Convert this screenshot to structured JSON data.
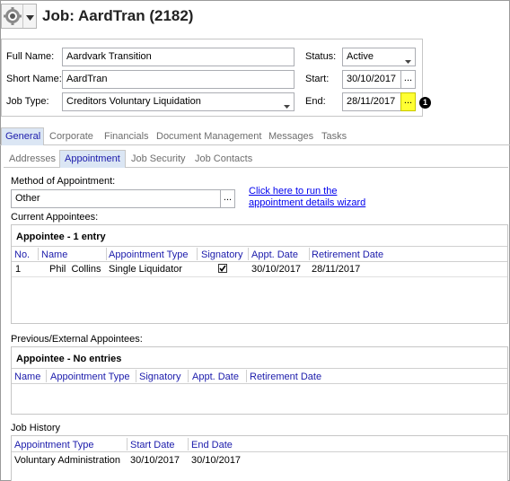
{
  "header": {
    "title": "Job: AardTran (2182)",
    "app_icon": "gear-icon",
    "dropdown_icon": "chevron-down-icon"
  },
  "job": {
    "full_name_label": "Full Name:",
    "full_name": "Aardvark Transition",
    "short_name_label": "Short Name:",
    "short_name": "AardTran",
    "job_type_label": "Job Type:",
    "job_type": "Creditors Voluntary Liquidation",
    "status_label": "Status:",
    "status": "Active",
    "start_label": "Start:",
    "start": "30/10/2017",
    "end_label": "End:",
    "end": "28/11/2017",
    "ellipsis": "...",
    "marker": "1"
  },
  "main_tabs": [
    "General",
    "Corporate",
    "Financials",
    "Document Management",
    "Messages",
    "Tasks"
  ],
  "sub_tabs": [
    "Addresses",
    "Appointment",
    "Job Security",
    "Job Contacts"
  ],
  "appointment": {
    "method_label": "Method of Appointment:",
    "method_value": "Other",
    "ellipsis": "...",
    "wizard_link_line1": "Click here to run the",
    "wizard_link_line2": "appointment details wizard",
    "current_label": "Current Appointees:",
    "current_group": "Appointee - 1 entry",
    "current_columns": [
      "No.",
      "Name",
      "Appointment Type",
      "Signatory",
      "Appt. Date",
      "Retirement Date"
    ],
    "current_rows": [
      {
        "no": "1",
        "name": "Phil  Collins",
        "type": "Single Liquidator",
        "signatory": true,
        "appt": "30/10/2017",
        "retire": "28/11/2017"
      }
    ],
    "previous_label": "Previous/External Appointees:",
    "previous_group": "Appointee - No entries",
    "previous_columns": [
      "Name",
      "Appointment Type",
      "Signatory",
      "Appt. Date",
      "Retirement Date"
    ],
    "history_label": "Job History",
    "history_columns": [
      "Appointment Type",
      "Start Date",
      "End Date"
    ],
    "history_rows": [
      {
        "type": "Voluntary Administration",
        "start": "30/10/2017",
        "end": "30/10/2017"
      }
    ]
  },
  "colors": {
    "active_tab_bg": "#dbe6f4",
    "highlight_yellow": "#ffff33",
    "header_text": "#1b1bab",
    "link": "#0000ee"
  }
}
